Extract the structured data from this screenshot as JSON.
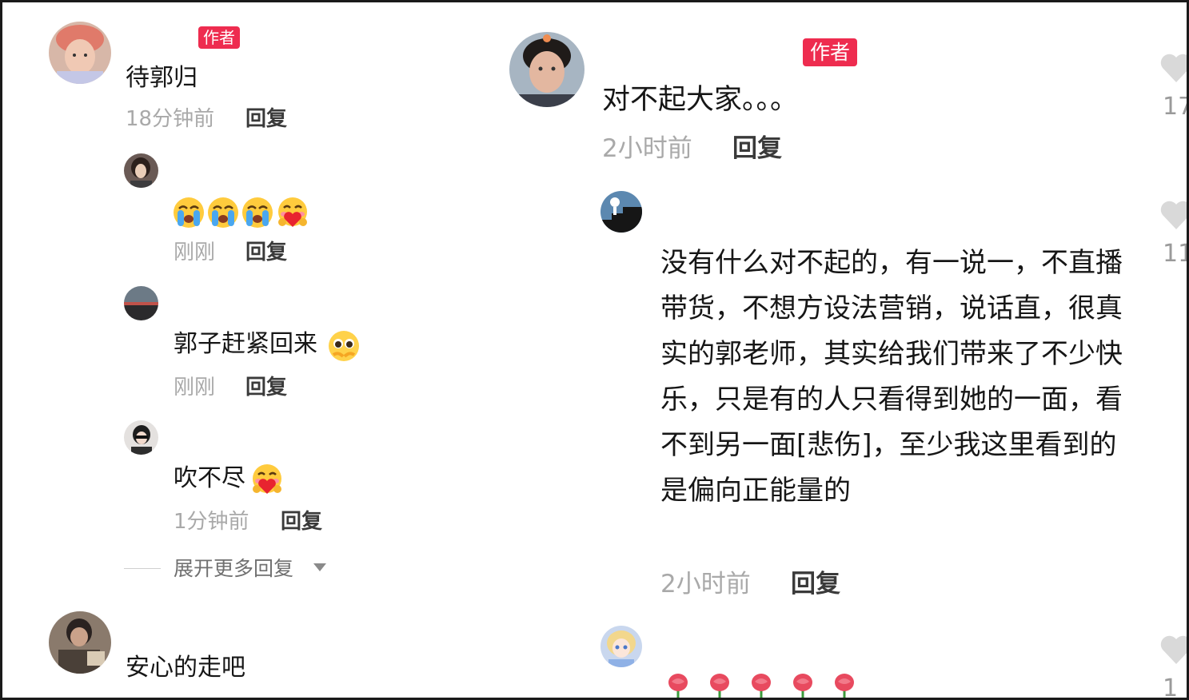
{
  "badges": {
    "author": "作者"
  },
  "left": {
    "root_comment": {
      "text": "待郭归",
      "time": "18分钟前",
      "reply": "回复"
    },
    "replies": [
      {
        "time": "刚刚",
        "reply": "回复"
      },
      {
        "text": "郭子赶紧回来",
        "time": "刚刚",
        "reply": "回复"
      },
      {
        "text": "吹不尽",
        "time": "1分钟前",
        "reply": "回复"
      }
    ],
    "expand_label": "展开更多回复",
    "next_comment": {
      "text": "安心的走吧"
    }
  },
  "right": {
    "root_comment": {
      "text": "对不起大家。。。",
      "time": "2小时前",
      "reply": "回复"
    },
    "reply": {
      "text": "没有什么对不起的，有一说一，不直播带货，不想方设法营销，说话直，很真实的郭老师，其实给我们带来了不少快乐，只是有的人只看得到她的一面，看不到另一面[悲伤]，至少我这里看到的是偏向正能量的",
      "time": "2小时前",
      "reply": "回复"
    },
    "like_counts": [
      "17",
      "11",
      "1"
    ]
  },
  "icons": {
    "emoji_crying": "loudly-crying-face-icon",
    "emoji_hugging_heart": "face-holding-heart-icon",
    "emoji_pleading": "pleading-face-icon",
    "emoji_rose": "rose-icon",
    "heart": "heart-icon",
    "caret": "caret-down-icon"
  },
  "colors": {
    "badge": "#ee2c4f",
    "time_text": "#a9a9a9",
    "heart": "#d9d9d9"
  }
}
